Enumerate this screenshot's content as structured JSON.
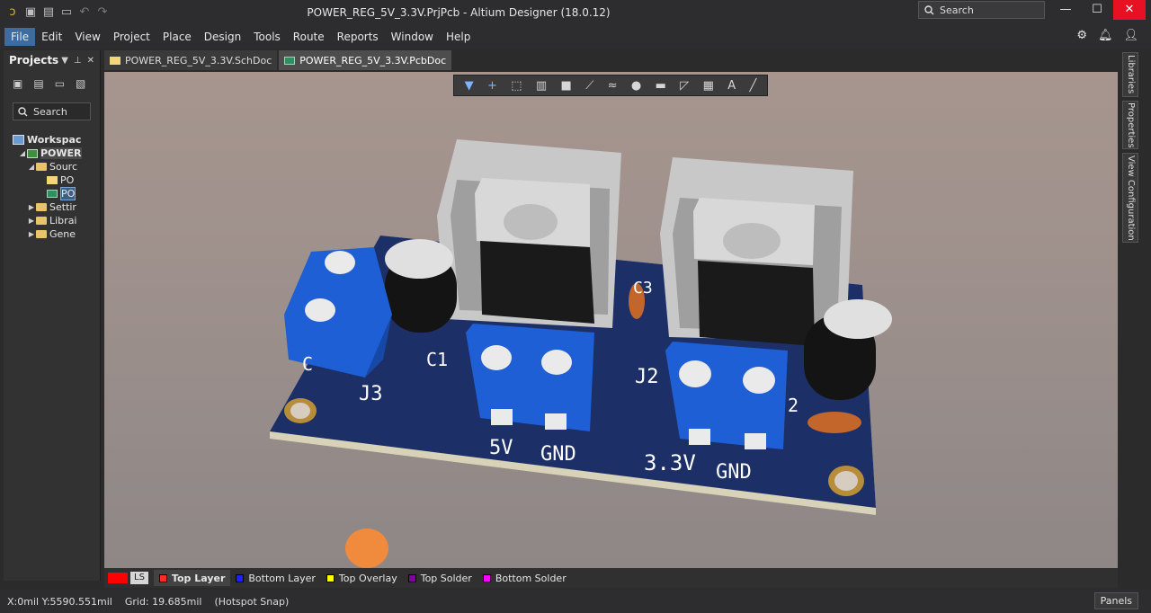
{
  "window": {
    "title": "POWER_REG_5V_3.3V.PrjPcb - Altium Designer (18.0.12)",
    "search_label": "Search",
    "minimize": "—",
    "maximize": "☐",
    "close": "✕"
  },
  "menu": [
    "File",
    "Edit",
    "View",
    "Project",
    "Place",
    "Design",
    "Tools",
    "Route",
    "Reports",
    "Window",
    "Help"
  ],
  "projects_panel": {
    "title": "Projects",
    "search_label": "Search",
    "tree": {
      "workspace": "Workspac",
      "project": "POWER",
      "source": "Sourc",
      "doc1": "PO",
      "doc2": "PO",
      "settings": "Settir",
      "libraries": "Librai",
      "generated": "Gene"
    }
  },
  "tabs": {
    "sch": "POWER_REG_5V_3.3V.SchDoc",
    "pcb": "POWER_REG_5V_3.3V.PcbDoc"
  },
  "right_panels": {
    "libraries": "Libraries",
    "properties": "Properties",
    "view_config": "View Configuration"
  },
  "board": {
    "labels": {
      "c1": "C1",
      "c3": "C3",
      "j2": "J2",
      "j3": "J3",
      "five_v": "5V",
      "gnd1": "GND",
      "three_v": "3.3V",
      "gnd2": "GND",
      "c_partial": "C",
      "two": "2"
    }
  },
  "layers": {
    "ls": "LS",
    "top": "Top Layer",
    "bottom": "Bottom Layer",
    "top_overlay": "Top Overlay",
    "top_solder": "Top Solder",
    "bottom_solder": "Bottom Solder",
    "colors": {
      "ls": "#ff0000",
      "top": "#ff2a2a",
      "bottom": "#2020ff",
      "top_overlay": "#ffff00",
      "top_solder": "#8000a0",
      "bottom_solder": "#ff00ff"
    }
  },
  "status": {
    "coords": "X:0mil Y:5590.551mil",
    "grid": "Grid: 19.685mil",
    "snap": "(Hotspot Snap)",
    "panels_button": "Panels"
  }
}
